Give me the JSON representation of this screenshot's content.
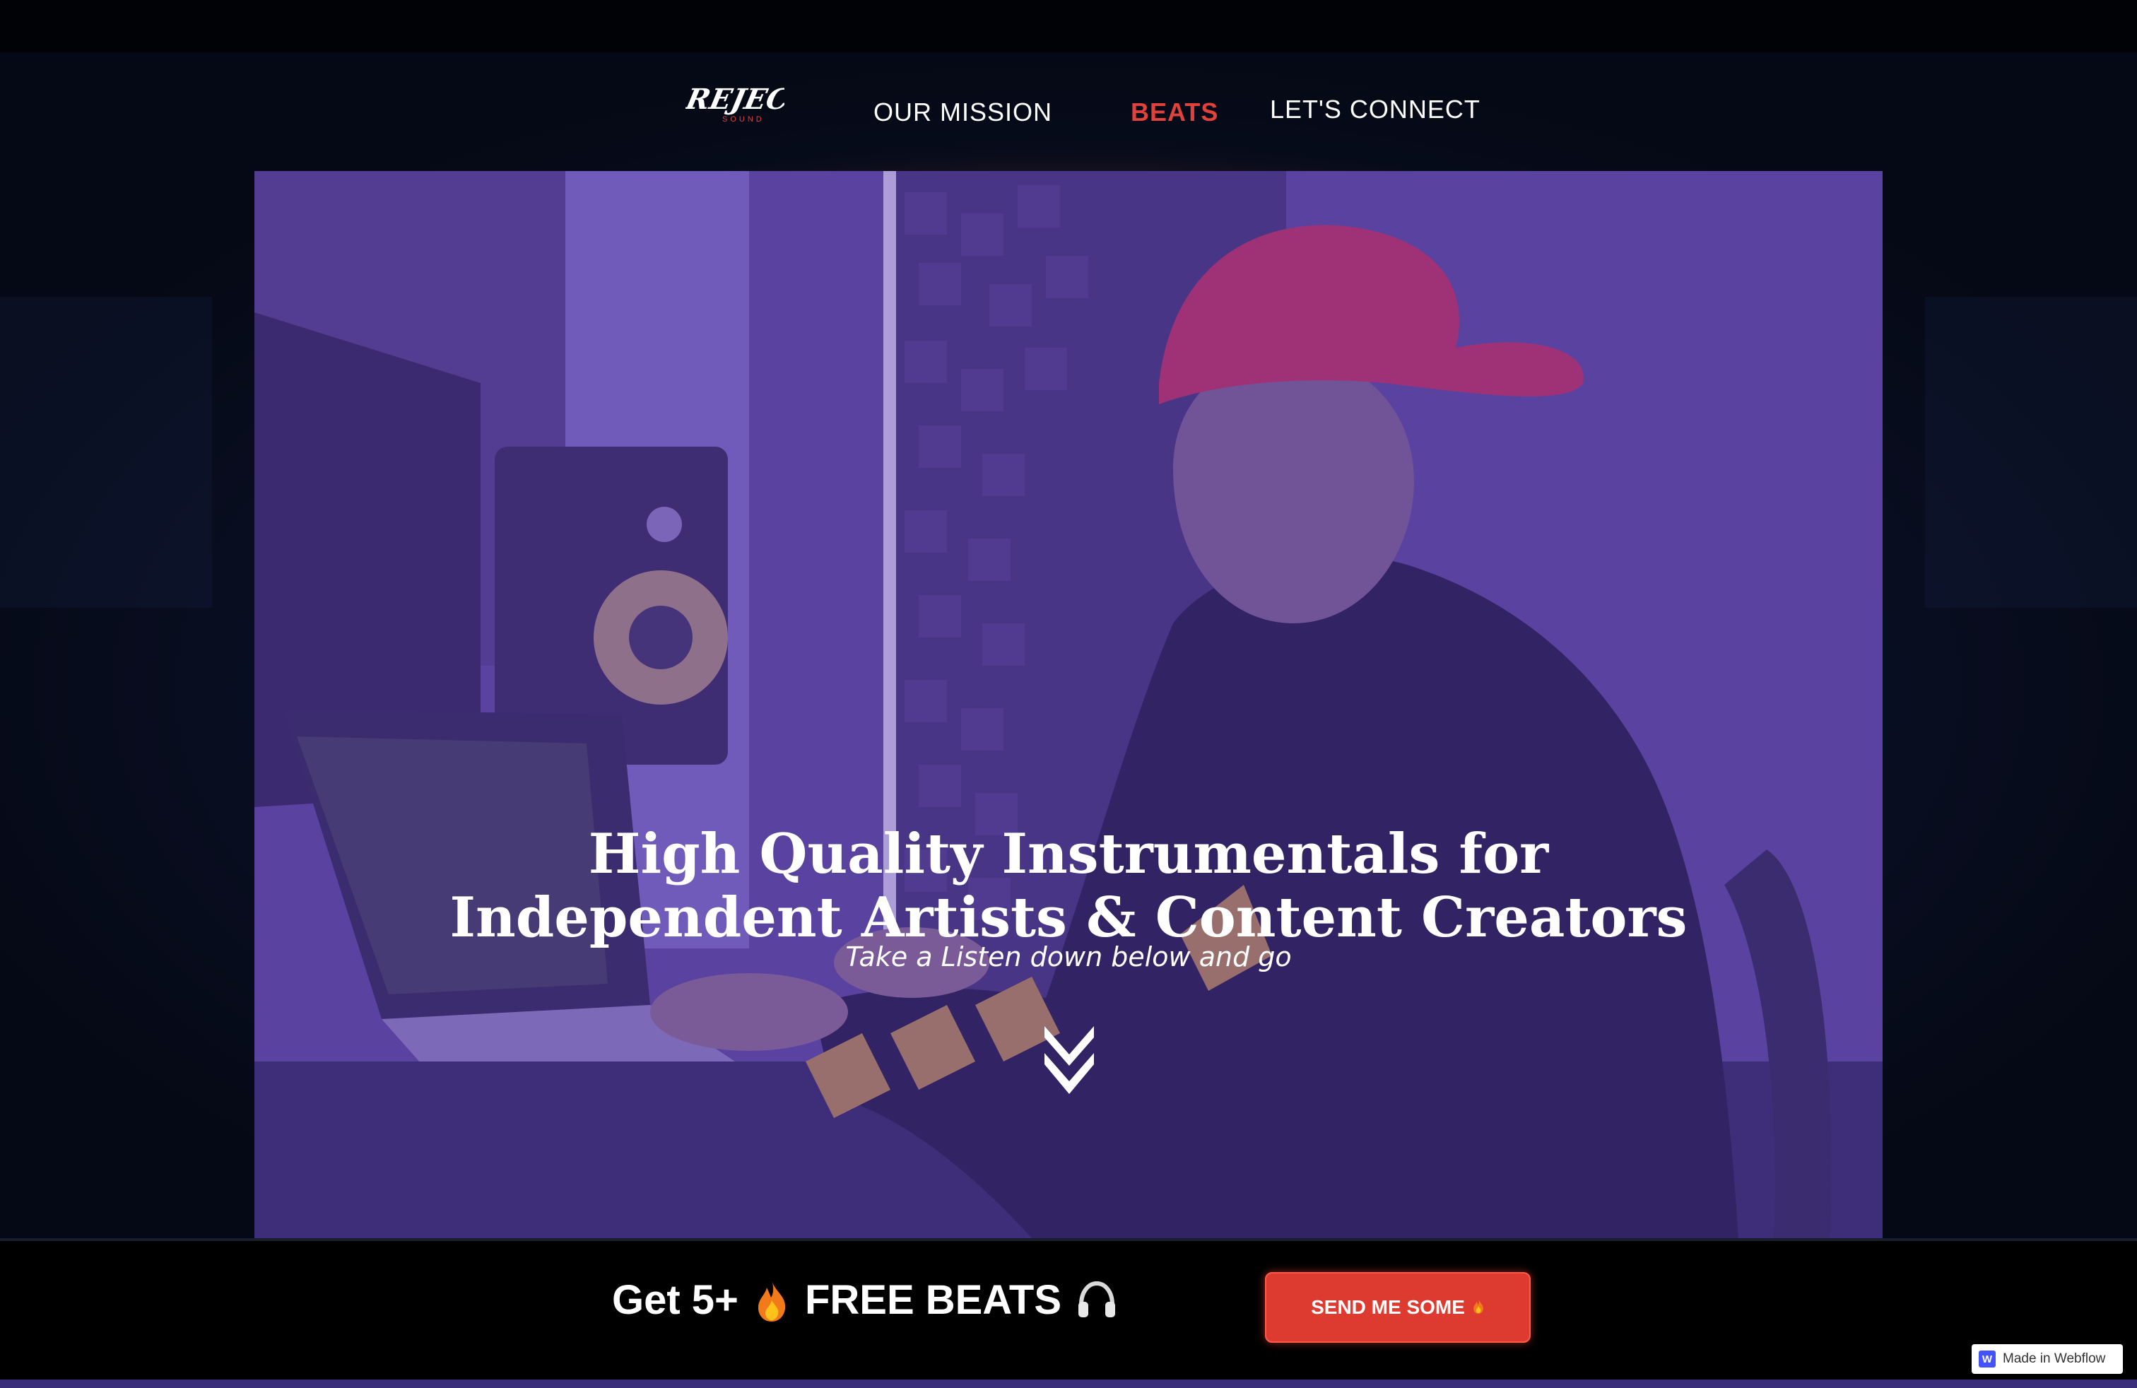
{
  "nav": {
    "logo_text": "REJECT",
    "logo_sub": "SOUND",
    "links": [
      {
        "label": "OUR MISSION"
      },
      {
        "label": "BEATS"
      },
      {
        "label": "LET'S CONNECT"
      }
    ]
  },
  "hero": {
    "headline_line1": "High Quality Instrumentals for",
    "headline_line2": "Independent Artists & Content Creators",
    "subline": "Take a Listen down below and go",
    "scroll_icon": "chevron-double-down-icon"
  },
  "promo": {
    "text_prefix": "Get 5+",
    "text_main": "FREE BEATS",
    "fire_icon": "fire-icon",
    "headphones_icon": "headphones-icon",
    "button_label": "SEND ME SOME"
  },
  "badge": {
    "label": "Made in Webflow",
    "icon_letter": "W"
  },
  "colors": {
    "accent": "#e0413b",
    "button": "#dd3a30",
    "hero_tint": "#5f4aa3"
  }
}
